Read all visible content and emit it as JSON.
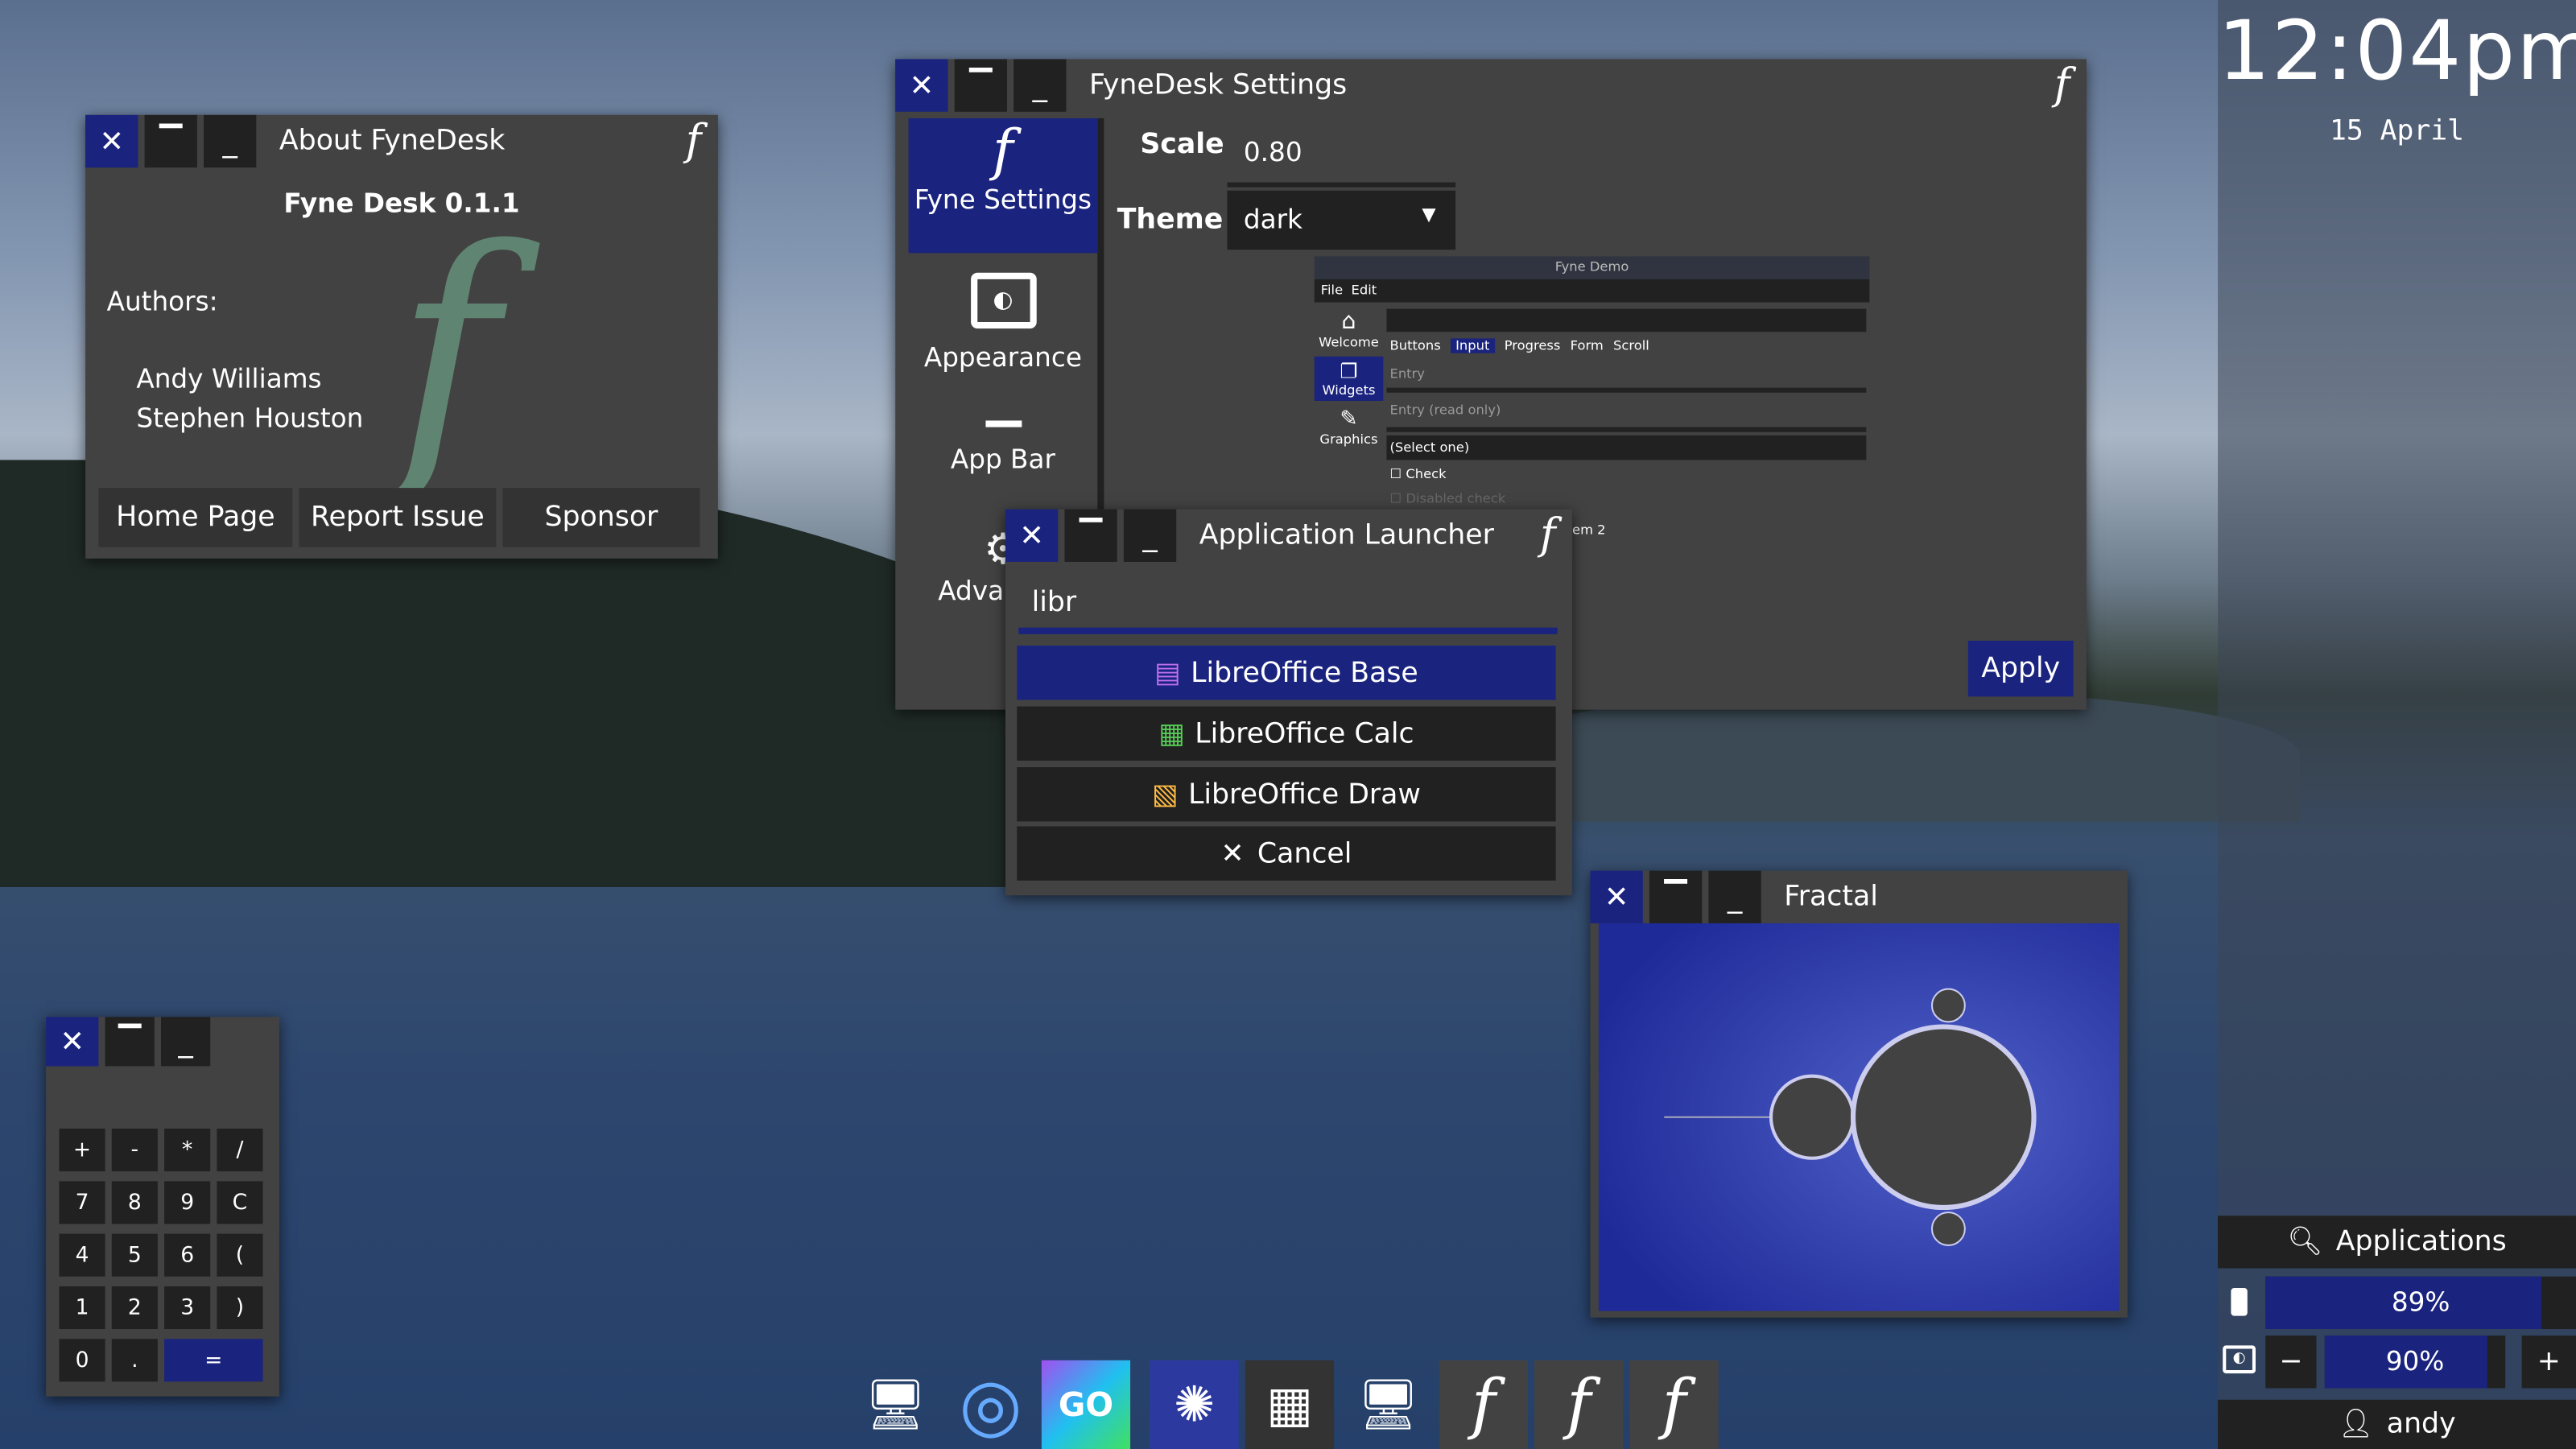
{
  "about": {
    "title": "About FyneDesk",
    "version": "Fyne Desk 0.1.1",
    "authors_label": "Authors:",
    "authors": [
      "Andy Williams",
      "Stephen Houston"
    ],
    "buttons": [
      "Home Page",
      "Report Issue",
      "Sponsor"
    ]
  },
  "settings": {
    "title": "FyneDesk Settings",
    "nav": [
      "Fyne Settings",
      "Appearance",
      "App Bar",
      "Advanced"
    ],
    "scale_label": "Scale",
    "scale_value": "0.80",
    "theme_label": "Theme",
    "theme_value": "dark",
    "apply": "Apply",
    "demo": {
      "title": "Fyne Demo",
      "menu": [
        "File",
        "Edit"
      ],
      "nav": [
        "Welcome",
        "Widgets",
        "Graphics"
      ],
      "tabs": [
        "Buttons",
        "Input",
        "Progress",
        "Form",
        "Scroll"
      ],
      "active_tab": "Input",
      "entry_placeholder": "Entry",
      "readonly_placeholder": "Entry (read only)",
      "select": "(Select one)",
      "check": "Check",
      "disabled_check": "Disabled check",
      "item": "em 2"
    }
  },
  "launcher": {
    "title": "Application Launcher",
    "query": "libr",
    "results": [
      "LibreOffice Base",
      "LibreOffice Calc",
      "LibreOffice Draw"
    ],
    "cancel": "Cancel"
  },
  "fractal": {
    "title": "Fractal"
  },
  "calculator": {
    "keys": [
      "+",
      "-",
      "*",
      "/",
      "7",
      "8",
      "9",
      "C",
      "4",
      "5",
      "6",
      "(",
      "1",
      "2",
      "3",
      ")",
      "0",
      ".",
      "="
    ]
  },
  "panel": {
    "time": "12:04pm",
    "date": "15 April",
    "applications": "Applications",
    "battery": "89%",
    "battery_level": 0.89,
    "brightness": "90%",
    "brightness_level": 0.9,
    "user": "andy"
  },
  "taskbar": [
    "display-icon",
    "chromium-icon",
    "goland-icon",
    "fractal-icon",
    "calculator-icon",
    "display-icon",
    "fyne-icon",
    "fyne-icon",
    "fyne-icon"
  ],
  "colors": {
    "accent": "#1a237e",
    "window": "#424242",
    "button": "#212121"
  }
}
